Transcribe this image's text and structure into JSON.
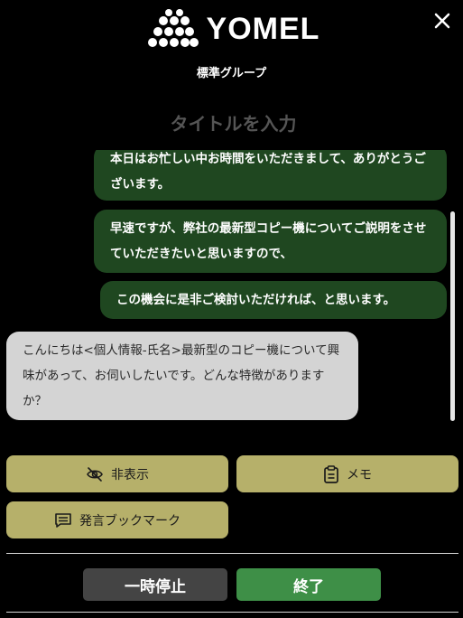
{
  "header": {
    "logo_text": "YOMEL",
    "group_label": "標準グループ",
    "title_placeholder": "タイトルを入力"
  },
  "messages": [
    {
      "sender": "self",
      "text": "本日はお忙しい中お時間をいただきまして、ありがとうございます。"
    },
    {
      "sender": "self",
      "text": "早速ですが、弊社の最新型コピー機についてご説明をさせていただきたいと思いますので、"
    },
    {
      "sender": "self",
      "text": "この機会に是非ご検討いただければ、と思います。"
    },
    {
      "sender": "other",
      "text": "こんにちは<個人情報-氏名>最新型のコピー機について興味があって、お伺いしたいです。どんな特徴がありますか？"
    }
  ],
  "controls": {
    "hide_label": "非表示",
    "memo_label": "メモ",
    "bookmark_label": "発言ブックマーク"
  },
  "actions": {
    "pause_label": "一時停止",
    "end_label": "終了"
  },
  "colors": {
    "self_bubble": "#1f4720",
    "other_bubble": "#d4d4d4",
    "control_button": "#b6b06a",
    "pause_button": "#444444",
    "end_button": "#3e8f47"
  },
  "icons": {
    "close": "close-icon",
    "hide": "eye-off-icon",
    "memo": "clipboard-icon",
    "bookmark": "message-lines-icon",
    "logo": "dot-network-logo"
  }
}
